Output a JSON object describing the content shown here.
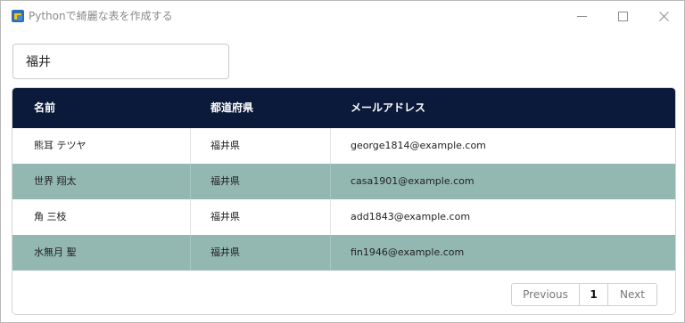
{
  "window": {
    "title": "Pythonで綺麗な表を作成する"
  },
  "search": {
    "value": "福井"
  },
  "table": {
    "columns": [
      "名前",
      "都道府県",
      "メールアドレス"
    ],
    "rows": [
      {
        "name": "熊耳 テツヤ",
        "prefecture": "福井県",
        "email": "george1814@example.com"
      },
      {
        "name": "世界 翔太",
        "prefecture": "福井県",
        "email": "casa1901@example.com"
      },
      {
        "name": "角 三枝",
        "prefecture": "福井県",
        "email": "add1843@example.com"
      },
      {
        "name": "水無月 聖",
        "prefecture": "福井県",
        "email": "fin1946@example.com"
      }
    ],
    "header_color": "#0b1a3a",
    "stripe_color": "#93b8b2"
  },
  "pagination": {
    "previous_label": "Previous",
    "current_page": "1",
    "next_label": "Next"
  }
}
